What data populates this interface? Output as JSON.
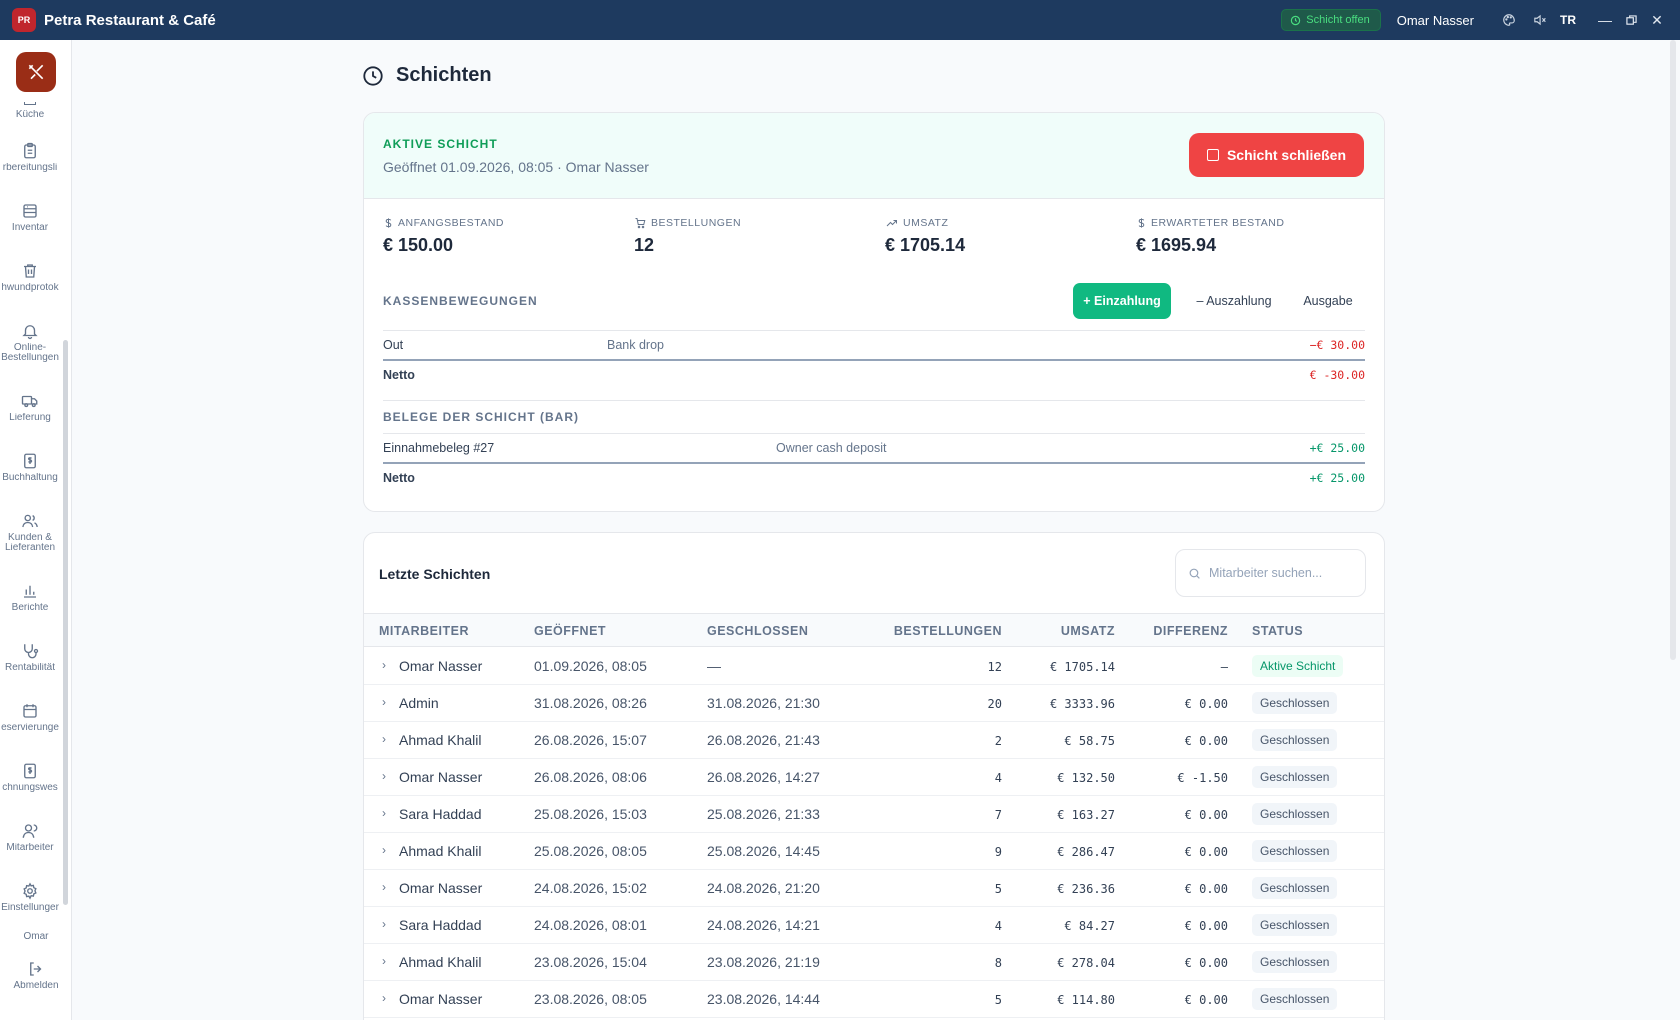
{
  "app": {
    "title": "Petra Restaurant & Café",
    "logo_text": "PR",
    "shift_status": "Schicht offen",
    "user": "Omar Nasser",
    "lang": "TR",
    "colors": {
      "titlebar": "#1e3a5f",
      "accent_red": "#ef4444",
      "accent_green": "#10b981",
      "brand": "#9a2d16"
    }
  },
  "sidebar": {
    "items": [
      {
        "label": "Küche",
        "icon": "chef-hat-icon"
      },
      {
        "label": "rbereitungsli",
        "icon": "clipboard-list-icon"
      },
      {
        "label": "Inventar",
        "icon": "archive-icon"
      },
      {
        "label": "hwundprotok",
        "icon": "trash-icon"
      },
      {
        "label": "Online-",
        "label2": "Bestellungen",
        "icon": "bell-icon"
      },
      {
        "label": "Lieferung",
        "icon": "truck-icon"
      },
      {
        "label": "Buchhaltung",
        "icon": "dollar-doc-icon"
      },
      {
        "label": "Kunden &",
        "label2": "Lieferanten",
        "icon": "users-icon"
      },
      {
        "label": "Berichte",
        "icon": "bar-chart-icon"
      },
      {
        "label": "Rentabilität",
        "icon": "stethoscope-icon"
      },
      {
        "label": "eservierunge",
        "icon": "calendar-icon"
      },
      {
        "label": "chnungswes",
        "icon": "dollar-doc-icon"
      },
      {
        "label": "Mitarbeiter",
        "icon": "user-group-icon"
      },
      {
        "label": "Einstellunger",
        "icon": "gear-icon"
      }
    ],
    "user": "Omar",
    "logout": "Abmelden"
  },
  "page": {
    "title": "Schichten"
  },
  "active_shift": {
    "label": "AKTIVE SCHICHT",
    "subtitle": "Geöffnet 01.09.2026, 08:05 · Omar Nasser",
    "close_button": "Schicht schließen",
    "stats": [
      {
        "label": "ANFANGSBESTAND",
        "value": "€ 150.00",
        "icon": "dollar-icon"
      },
      {
        "label": "BESTELLUNGEN",
        "value": "12",
        "icon": "cart-icon"
      },
      {
        "label": "UMSATZ",
        "value": "€ 1705.14",
        "icon": "trending-up-icon"
      },
      {
        "label": "ERWARTETER BESTAND",
        "value": "€ 1695.94",
        "icon": "dollar-icon"
      }
    ],
    "movements": {
      "label": "KASSENBEWEGUNGEN",
      "btn_in": "+ Einzahlung",
      "btn_out": "– Auszahlung",
      "btn_expense": "Ausgabe",
      "rows": [
        {
          "type": "Out",
          "note": "Bank drop",
          "amount": "−€ 30.00"
        }
      ],
      "net_label": "Netto",
      "net_amount": "€ -30.00"
    },
    "receipts": {
      "label": "BELEGE DER SCHICHT (BAR)",
      "rows": [
        {
          "name": "Einnahmebeleg #27",
          "note": "Owner cash deposit",
          "amount": "+€ 25.00"
        }
      ],
      "net_label": "Netto",
      "net_amount": "+€ 25.00"
    }
  },
  "recent": {
    "title": "Letzte Schichten",
    "search_placeholder": "Mitarbeiter suchen...",
    "columns": [
      "MITARBEITER",
      "GEÖFFNET",
      "GESCHLOSSEN",
      "BESTELLUNGEN",
      "UMSATZ",
      "DIFFERENZ",
      "STATUS"
    ],
    "rows": [
      {
        "employee": "Omar Nasser",
        "opened": "01.09.2026, 08:05",
        "closed": "—",
        "orders": "12",
        "revenue": "€ 1705.14",
        "diff": "–",
        "status": "Aktive Schicht",
        "active": true
      },
      {
        "employee": "Admin",
        "opened": "31.08.2026, 08:26",
        "closed": "31.08.2026, 21:30",
        "orders": "20",
        "revenue": "€ 3333.96",
        "diff": "€ 0.00",
        "status": "Geschlossen"
      },
      {
        "employee": "Ahmad Khalil",
        "opened": "26.08.2026, 15:07",
        "closed": "26.08.2026, 21:43",
        "orders": "2",
        "revenue": "€ 58.75",
        "diff": "€ 0.00",
        "status": "Geschlossen"
      },
      {
        "employee": "Omar Nasser",
        "opened": "26.08.2026, 08:06",
        "closed": "26.08.2026, 14:27",
        "orders": "4",
        "revenue": "€ 132.50",
        "diff": "€ -1.50",
        "status": "Geschlossen",
        "neg": true
      },
      {
        "employee": "Sara Haddad",
        "opened": "25.08.2026, 15:03",
        "closed": "25.08.2026, 21:33",
        "orders": "7",
        "revenue": "€ 163.27",
        "diff": "€ 0.00",
        "status": "Geschlossen"
      },
      {
        "employee": "Ahmad Khalil",
        "opened": "25.08.2026, 08:05",
        "closed": "25.08.2026, 14:45",
        "orders": "9",
        "revenue": "€ 286.47",
        "diff": "€ 0.00",
        "status": "Geschlossen"
      },
      {
        "employee": "Omar Nasser",
        "opened": "24.08.2026, 15:02",
        "closed": "24.08.2026, 21:20",
        "orders": "5",
        "revenue": "€ 236.36",
        "diff": "€ 0.00",
        "status": "Geschlossen"
      },
      {
        "employee": "Sara Haddad",
        "opened": "24.08.2026, 08:01",
        "closed": "24.08.2026, 14:21",
        "orders": "4",
        "revenue": "€ 84.27",
        "diff": "€ 0.00",
        "status": "Geschlossen"
      },
      {
        "employee": "Ahmad Khalil",
        "opened": "23.08.2026, 15:04",
        "closed": "23.08.2026, 21:19",
        "orders": "8",
        "revenue": "€ 278.04",
        "diff": "€ 0.00",
        "status": "Geschlossen"
      },
      {
        "employee": "Omar Nasser",
        "opened": "23.08.2026, 08:05",
        "closed": "23.08.2026, 14:44",
        "orders": "5",
        "revenue": "€ 114.80",
        "diff": "€ 0.00",
        "status": "Geschlossen"
      }
    ]
  }
}
